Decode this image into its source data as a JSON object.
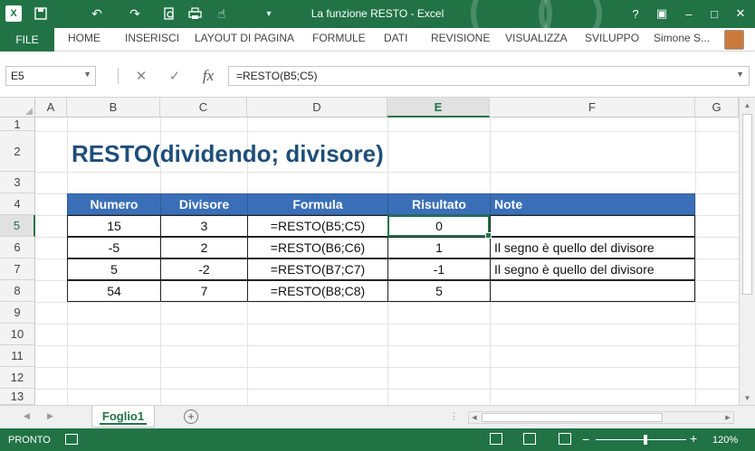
{
  "window": {
    "title": "La funzione RESTO - Excel",
    "controls": [
      "?",
      "▣",
      "–",
      "□",
      "✕"
    ]
  },
  "quick_access": [
    "save-icon",
    "undo-icon",
    "redo-icon",
    "print-preview-icon",
    "print-icon",
    "touch-mode-icon",
    "customize-icon"
  ],
  "ribbon": {
    "file": "FILE",
    "tabs": [
      "HOME",
      "INSERISCI",
      "LAYOUT DI PAGINA",
      "FORMULE",
      "DATI",
      "REVISIONE",
      "VISUALIZZA",
      "SVILUPPO"
    ],
    "user": "Simone S..."
  },
  "formula_bar": {
    "name_box": "E5",
    "fx": "fx",
    "formula": "=RESTO(B5;C5)"
  },
  "columns": [
    "A",
    "B",
    "C",
    "D",
    "E",
    "F",
    "G"
  ],
  "rows": [
    "1",
    "2",
    "3",
    "4",
    "5",
    "6",
    "7",
    "8",
    "9",
    "10",
    "11",
    "12",
    "13"
  ],
  "selected_cell": {
    "column": "E",
    "row": "5"
  },
  "sheet": {
    "title": "RESTO(dividendo; divisore)",
    "headers": [
      "Numero",
      "Divisore",
      "Formula",
      "Risultato",
      "Note"
    ],
    "rows": [
      [
        "15",
        "3",
        "=RESTO(B5;C5)",
        "0",
        ""
      ],
      [
        "-5",
        "2",
        "=RESTO(B6;C6)",
        "1",
        "Il segno è quello del divisore"
      ],
      [
        "5",
        "-2",
        "=RESTO(B7;C7)",
        "-1",
        "Il segno è quello del divisore"
      ],
      [
        "54",
        "7",
        "=RESTO(B8;C8)",
        "5",
        ""
      ]
    ]
  },
  "sheet_tabs": {
    "active": "Foglio1",
    "add": "+"
  },
  "status": {
    "text": "PRONTO",
    "zoom": "120%",
    "zoom_level": 0.55
  },
  "colors": {
    "excel_green": "#217346",
    "table_header": "#3a6fb7",
    "title_blue": "#1f4e79"
  }
}
